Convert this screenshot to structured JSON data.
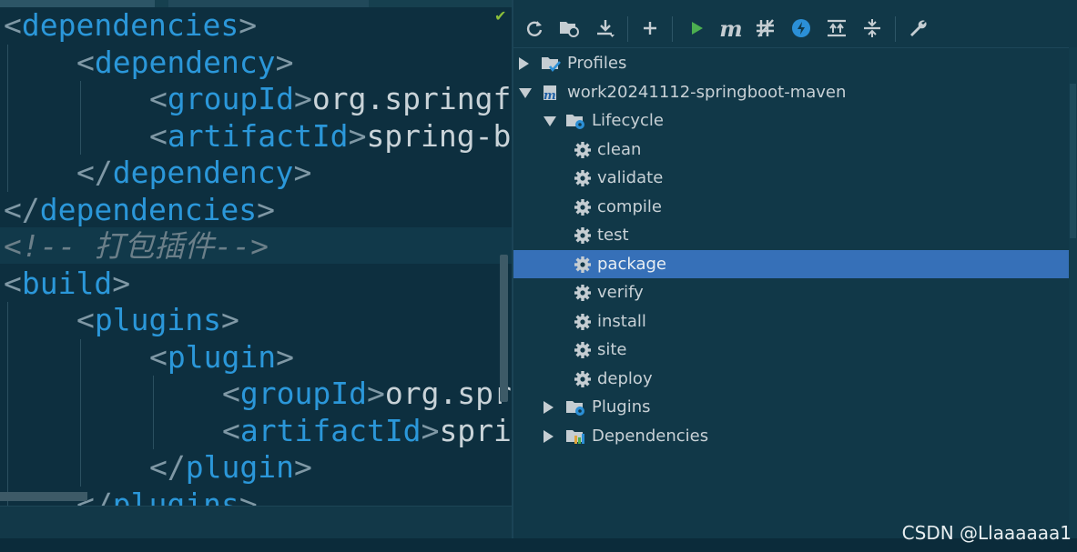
{
  "editor": {
    "lines": [
      {
        "indent": 0,
        "pre": "<",
        "tag": "dependencies",
        "post": ">",
        "text": ""
      },
      {
        "indent": 1,
        "pre": "<",
        "tag": "dependency",
        "post": ">",
        "text": ""
      },
      {
        "indent": 2,
        "pre": "<",
        "tag": "groupId",
        "post": ">",
        "text": "org.springf"
      },
      {
        "indent": 2,
        "pre": "<",
        "tag": "artifactId",
        "post": ">",
        "text": "spring-b"
      },
      {
        "indent": 1,
        "pre": "</",
        "tag": "dependency",
        "post": ">",
        "text": ""
      },
      {
        "indent": 0,
        "pre": "</",
        "tag": "dependencies",
        "post": ">",
        "text": ""
      },
      {
        "indent": 0,
        "comment": "<!-- 打包插件-->"
      },
      {
        "indent": 0,
        "pre": "<",
        "tag": "build",
        "post": ">",
        "text": ""
      },
      {
        "indent": 1,
        "pre": "<",
        "tag": "plugins",
        "post": ">",
        "text": ""
      },
      {
        "indent": 2,
        "pre": "<",
        "tag": "plugin",
        "post": ">",
        "text": ""
      },
      {
        "indent": 3,
        "pre": "<",
        "tag": "groupId",
        "post": ">",
        "text": "org.spr"
      },
      {
        "indent": 3,
        "pre": "<",
        "tag": "artifactId",
        "post": ">",
        "text": "spri"
      },
      {
        "indent": 2,
        "pre": "</",
        "tag": "plugin",
        "post": ">",
        "text": ""
      },
      {
        "indent": 1,
        "pre": "</",
        "tag": "plugins",
        "post": ">",
        "text": ""
      }
    ]
  },
  "maven": {
    "toolbar": [
      {
        "name": "reload-icon",
        "glyph": "⟳"
      },
      {
        "name": "generate-sources-icon",
        "glyph": ""
      },
      {
        "name": "download-icon",
        "glyph": ""
      },
      {
        "name": "add-icon",
        "glyph": "+"
      },
      {
        "name": "run-icon",
        "glyph": ""
      },
      {
        "name": "execute-goal-icon",
        "glyph": "m"
      },
      {
        "name": "toggle-offline-icon",
        "glyph": ""
      },
      {
        "name": "skip-tests-icon",
        "glyph": "⚡"
      },
      {
        "name": "show-dependencies-icon",
        "glyph": ""
      },
      {
        "name": "collapse-all-icon",
        "glyph": ""
      },
      {
        "name": "settings-icon",
        "glyph": ""
      }
    ],
    "tree": [
      {
        "label": "Profiles",
        "level": 0,
        "arrow": "right",
        "icon": "profiles",
        "selected": false
      },
      {
        "label": "work20241112-springboot-maven",
        "level": 0,
        "arrow": "down",
        "icon": "project",
        "selected": false
      },
      {
        "label": "Lifecycle",
        "level": 1,
        "arrow": "down",
        "icon": "folder-gear",
        "selected": false
      },
      {
        "label": "clean",
        "level": 2,
        "arrow": "",
        "icon": "gear",
        "selected": false
      },
      {
        "label": "validate",
        "level": 2,
        "arrow": "",
        "icon": "gear",
        "selected": false
      },
      {
        "label": "compile",
        "level": 2,
        "arrow": "",
        "icon": "gear",
        "selected": false
      },
      {
        "label": "test",
        "level": 2,
        "arrow": "",
        "icon": "gear",
        "selected": false
      },
      {
        "label": "package",
        "level": 2,
        "arrow": "",
        "icon": "gear",
        "selected": true
      },
      {
        "label": "verify",
        "level": 2,
        "arrow": "",
        "icon": "gear",
        "selected": false
      },
      {
        "label": "install",
        "level": 2,
        "arrow": "",
        "icon": "gear",
        "selected": false
      },
      {
        "label": "site",
        "level": 2,
        "arrow": "",
        "icon": "gear",
        "selected": false
      },
      {
        "label": "deploy",
        "level": 2,
        "arrow": "",
        "icon": "gear",
        "selected": false
      },
      {
        "label": "Plugins",
        "level": 1,
        "arrow": "right",
        "icon": "folder-gear",
        "selected": false
      },
      {
        "label": "Dependencies",
        "level": 1,
        "arrow": "right",
        "icon": "dependencies",
        "selected": false
      }
    ]
  },
  "watermark": "CSDN @Llaaaaaa1",
  "colors": {
    "tag": "#2b97d9",
    "bracket": "#7f98a5",
    "text": "#c9d3d8",
    "comment": "#6b7f89",
    "selection": "#3670b8",
    "run": "#4caf50",
    "skip": "#2b8fd6"
  }
}
